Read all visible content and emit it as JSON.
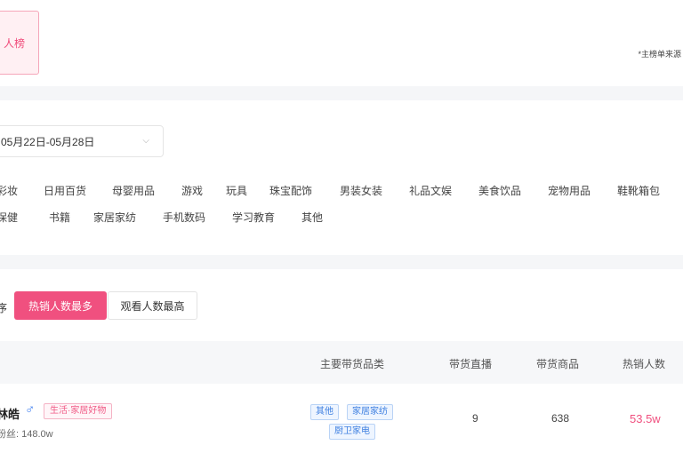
{
  "header": {
    "rank_tab_label": "人榜",
    "source_note": "*主榜单来源"
  },
  "filters": {
    "date_range": "05月22日-05月28日",
    "categories_row1": [
      "彩妆",
      "日用百货",
      "母婴用品",
      "游戏",
      "玩具",
      "珠宝配饰",
      "男装女装",
      "礼品文娱",
      "美食饮品",
      "宠物用品",
      "鞋靴箱包"
    ],
    "categories_row2": [
      "保健",
      "书籍",
      "家居家纺",
      "手机数码",
      "学习教育",
      "其他"
    ]
  },
  "sort": {
    "label": "序",
    "active": "热销人数最多",
    "inactive": "观看人数最高"
  },
  "table": {
    "columns": [
      "主要带货品类",
      "带货直播",
      "带货商品",
      "热销人数"
    ],
    "rows": [
      {
        "name": "林皓",
        "gender_symbol": "♂",
        "tag": "生活·家居好物",
        "fans": "粉丝: 148.0w",
        "categories": [
          "其他",
          "家居家纺",
          "厨卫家电"
        ],
        "lives": "9",
        "products": "638",
        "hot_count": "53.5w"
      }
    ]
  },
  "colors": {
    "accent": "#f0507f",
    "tag_blue": "#3d7fe0"
  }
}
